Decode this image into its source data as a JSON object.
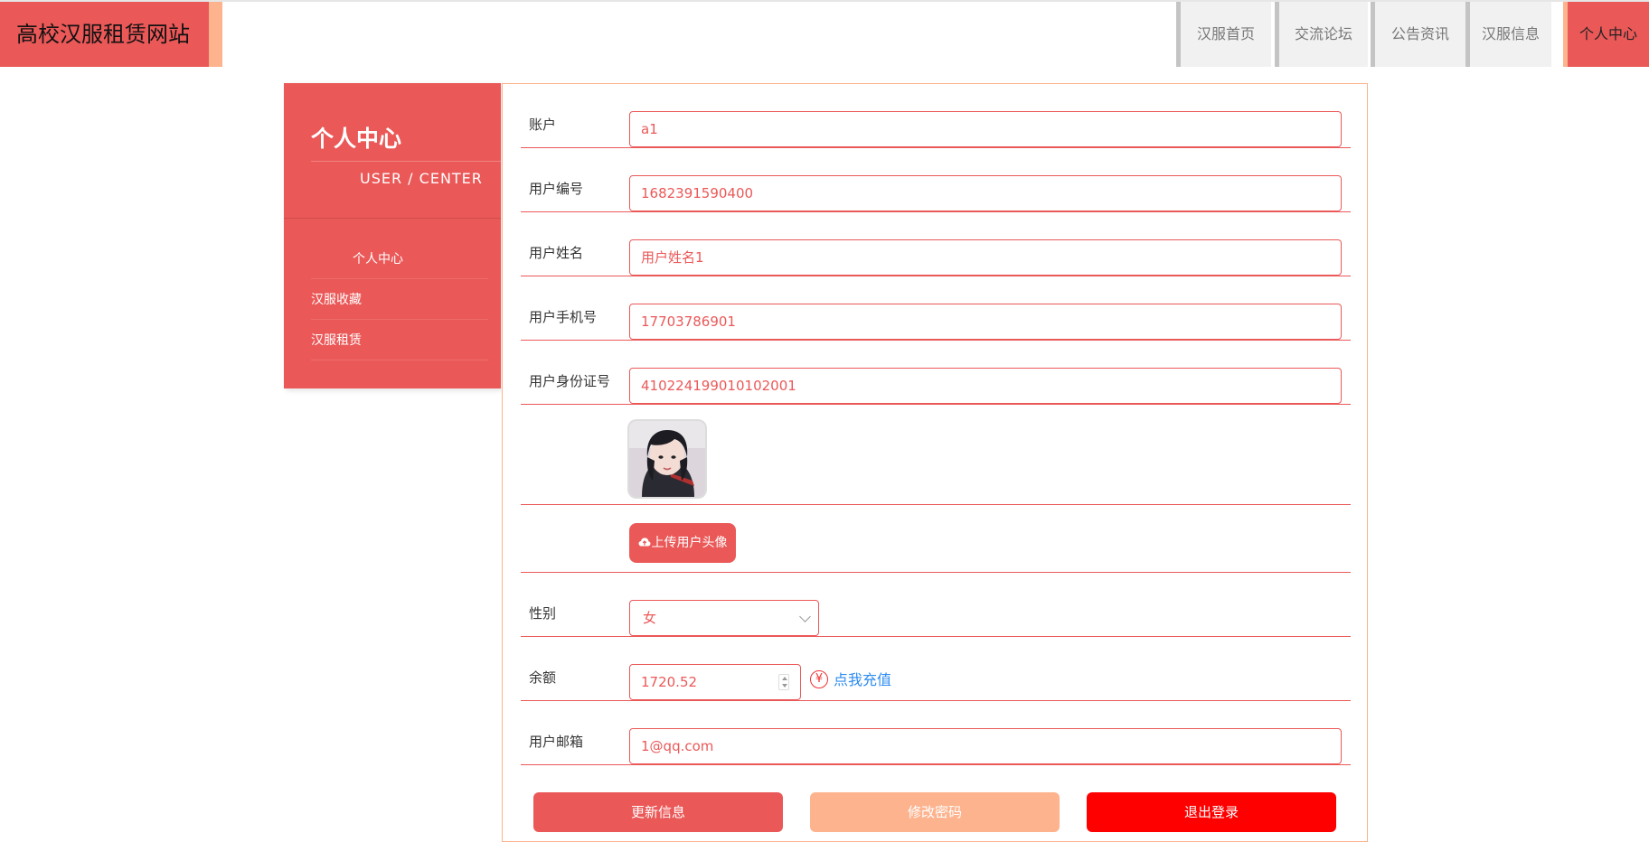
{
  "header": {
    "site_title": "高校汉服租赁网站",
    "nav": [
      {
        "label": "汉服首页"
      },
      {
        "label": "交流论坛"
      },
      {
        "label": "公告资讯"
      },
      {
        "label": "汉服信息"
      },
      {
        "label": "个人中心",
        "active": true
      }
    ]
  },
  "sidebar": {
    "title": "个人中心",
    "subtitle": "USER / CENTER",
    "items": [
      {
        "label": "个人中心"
      },
      {
        "label": "汉服收藏"
      },
      {
        "label": "汉服租赁"
      }
    ]
  },
  "form": {
    "account": {
      "label": "账户",
      "value": "a1"
    },
    "user_no": {
      "label": "用户编号",
      "value": "1682391590400"
    },
    "user_name": {
      "label": "用户姓名",
      "value": "用户姓名1"
    },
    "phone": {
      "label": "用户手机号",
      "value": "17703786901"
    },
    "id_card": {
      "label": "用户身份证号",
      "value": "410224199010102001"
    },
    "avatar": {
      "icon": "user-avatar-photo"
    },
    "upload_label": "上传用户头像",
    "gender": {
      "label": "性别",
      "value": "女"
    },
    "balance": {
      "label": "余额",
      "value": "1720.52",
      "recharge_label": "点我充值",
      "recharge_icon": "¥"
    },
    "email": {
      "label": "用户邮箱",
      "value": "1@qq.com"
    }
  },
  "actions": {
    "update": "更新信息",
    "change_password": "修改密码",
    "logout": "退出登录"
  },
  "colors": {
    "primary": "#eb5858",
    "accent": "#fdb38e",
    "logout": "#ff0000",
    "link": "#2d8cf0"
  }
}
